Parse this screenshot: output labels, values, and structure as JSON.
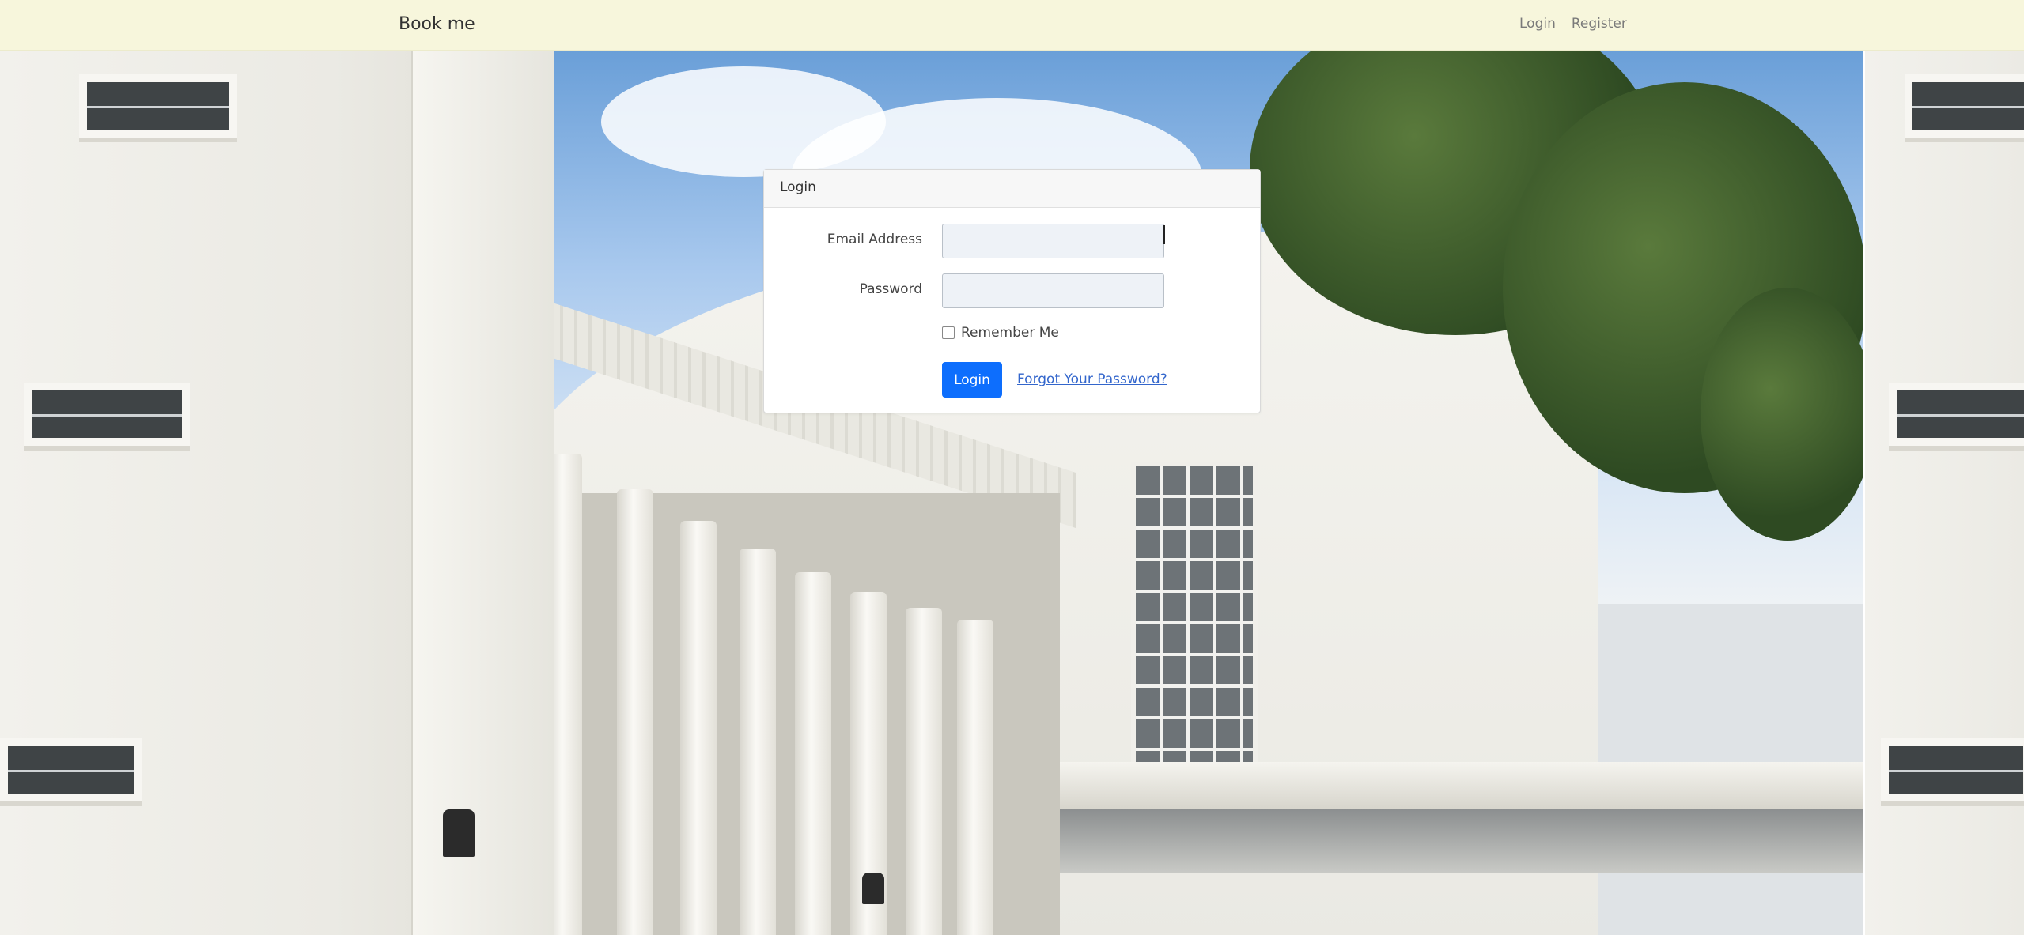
{
  "navbar": {
    "brand": "Book me",
    "links": [
      {
        "label": "Login"
      },
      {
        "label": "Register"
      }
    ]
  },
  "login_card": {
    "header": "Login",
    "email": {
      "label": "Email Address",
      "value": "",
      "placeholder": ""
    },
    "password": {
      "label": "Password",
      "value": "",
      "placeholder": ""
    },
    "remember": {
      "label": "Remember Me",
      "checked": false
    },
    "submit_label": "Login",
    "forgot_label": "Forgot Your Password?"
  },
  "colors": {
    "navbar_bg": "#f7f6dc",
    "primary_button": "#0d6efd",
    "link": "#3366cc"
  },
  "background": {
    "description_icon": "building-photo"
  }
}
